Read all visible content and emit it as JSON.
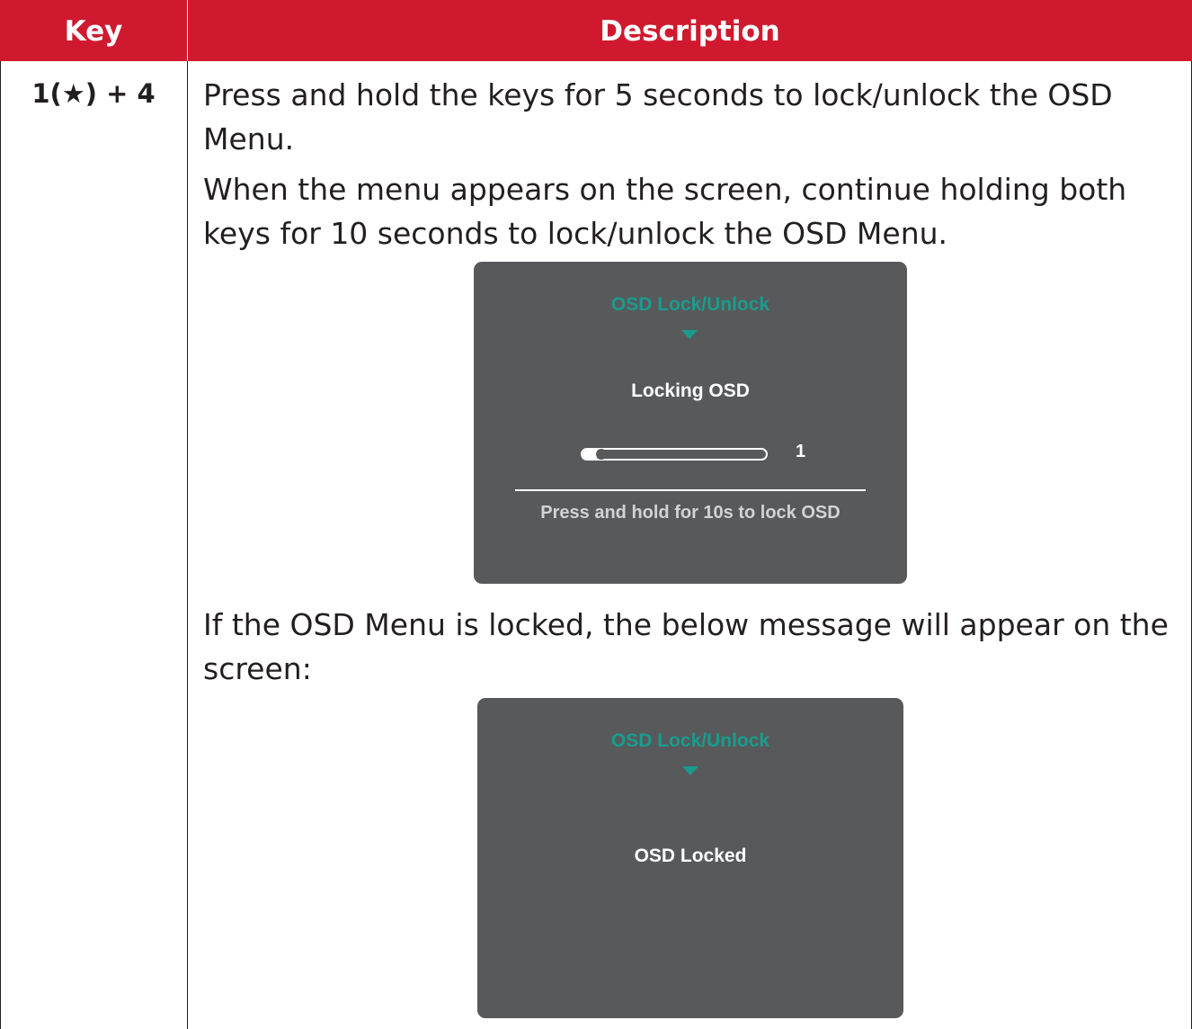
{
  "header": {
    "key_label": "Key",
    "description_label": "Description"
  },
  "row": {
    "key": "1(★) + 4",
    "paragraphs": [
      "Press and hold the keys for 5 seconds to lock/unlock the OSD Menu.",
      "When the menu appears on the screen, continue holding both keys for 10 seconds to lock/unlock the OSD Menu.",
      "If the OSD Menu is locked, the below message will appear on the screen:"
    ]
  },
  "osd_locking": {
    "title": "OSD Lock/Unlock",
    "message": "Locking OSD",
    "progress_value": "1",
    "progress_fraction": 0.1,
    "hint": "Press and hold for 10s to lock OSD"
  },
  "osd_locked": {
    "title": "OSD Lock/Unlock",
    "message": "OSD Locked"
  },
  "colors": {
    "header_bg": "#d0192f",
    "osd_bg": "#58595b",
    "osd_accent": "#199c8d"
  },
  "icons": {
    "key_star": "star-icon",
    "menu_pointer": "triangle-down-icon"
  }
}
